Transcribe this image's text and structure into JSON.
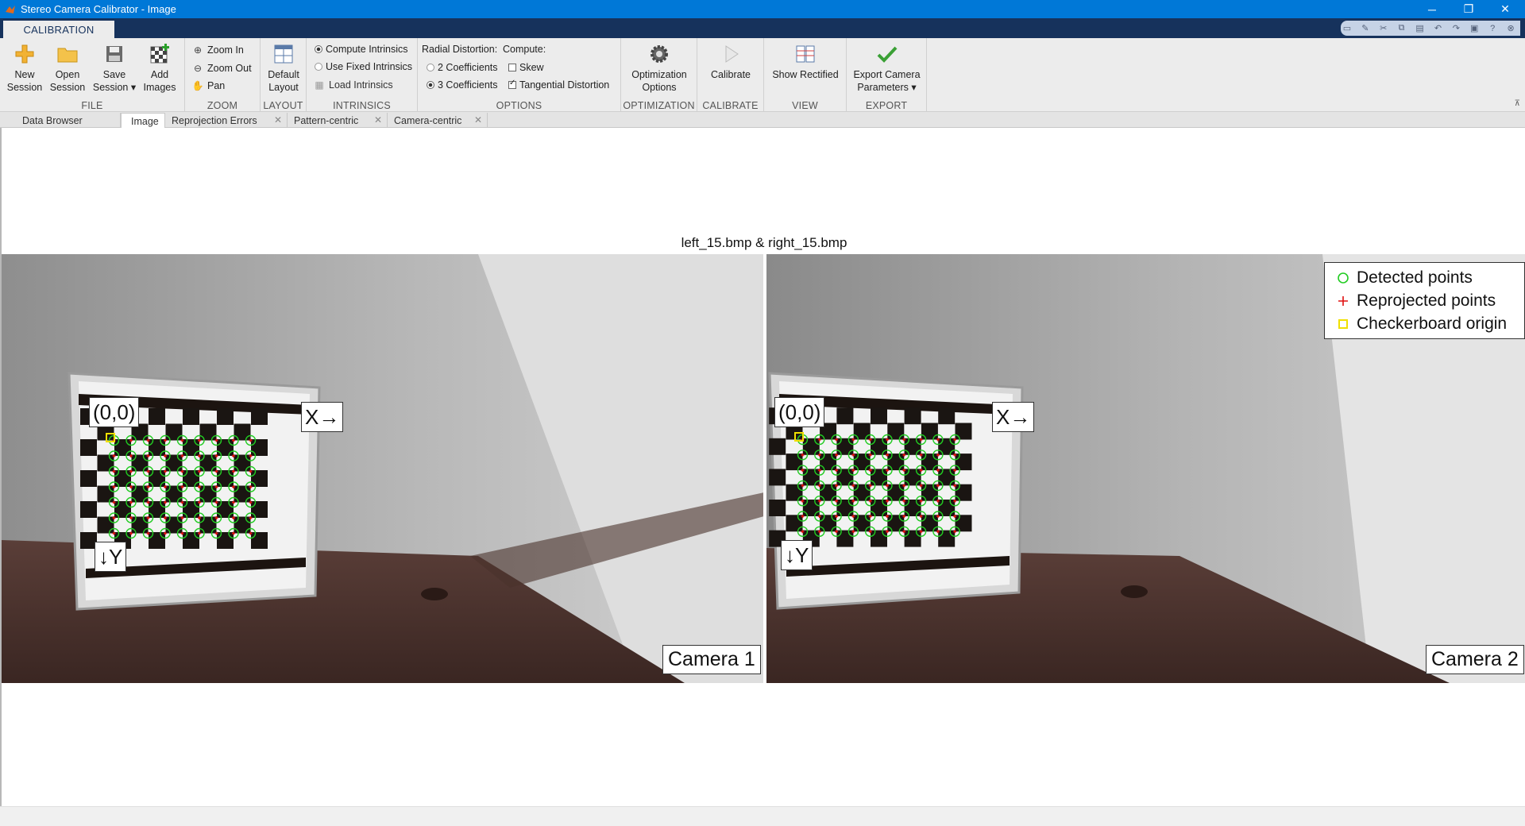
{
  "window": {
    "title": "Stereo Camera Calibrator - Image",
    "minimize": "─",
    "restore": "❐",
    "close": "✕"
  },
  "ribbon_tab": "CALIBRATION",
  "file": {
    "label": "FILE",
    "new_session": [
      "New",
      "Session"
    ],
    "open_session": [
      "Open",
      "Session"
    ],
    "save_session": [
      "Save",
      "Session"
    ],
    "add_images": [
      "Add",
      "Images"
    ]
  },
  "zoom": {
    "label": "ZOOM",
    "zoom_in": "Zoom In",
    "zoom_out": "Zoom Out",
    "pan": "Pan"
  },
  "layout": {
    "label": "LAYOUT",
    "default_layout": [
      "Default",
      "Layout"
    ]
  },
  "intrinsics": {
    "label": "INTRINSICS",
    "compute": "Compute Intrinsics",
    "use_fixed": "Use Fixed Intrinsics",
    "load": "Load Intrinsics"
  },
  "options": {
    "label": "OPTIONS",
    "radial_header": "Radial Distortion:",
    "compute_header": "Compute:",
    "two_coeff": "2 Coefficients",
    "three_coeff": "3 Coefficients",
    "skew": "Skew",
    "tangential": "Tangential Distortion",
    "skew_checked": false,
    "tangential_checked": true,
    "selected_radial": "3 Coefficients"
  },
  "optimization": {
    "label": "OPTIMIZATION",
    "button": [
      "Optimization",
      "Options"
    ]
  },
  "calibrate": {
    "label": "CALIBRATE",
    "button": "Calibrate"
  },
  "view": {
    "label": "VIEW",
    "button": "Show Rectified"
  },
  "export": {
    "label": "EXPORT",
    "button": [
      "Export Camera",
      "Parameters"
    ]
  },
  "doc_tabs": [
    {
      "label": "Data Browser",
      "closable": false
    },
    {
      "label": "Image",
      "closable": false,
      "active": true
    },
    {
      "label": "Reprojection Errors",
      "closable": true
    },
    {
      "label": "Pattern-centric",
      "closable": true
    },
    {
      "label": "Camera-centric",
      "closable": true
    }
  ],
  "figure": {
    "title": "left_15.bmp & right_15.bmp",
    "camera1": "Camera 1",
    "camera2": "Camera 2",
    "origin_label": "(0,0)",
    "x_label": "X→",
    "y_label": "↓Y"
  },
  "legend": {
    "detected": "Detected points",
    "reprojected": "Reprojected points",
    "origin": "Checkerboard origin"
  },
  "colors": {
    "title_bar": "#0078d7",
    "ribbon_tab_strip": "#16325c",
    "detected": "#22cc22",
    "reprojected": "#e01010",
    "origin": "#f0e000"
  }
}
